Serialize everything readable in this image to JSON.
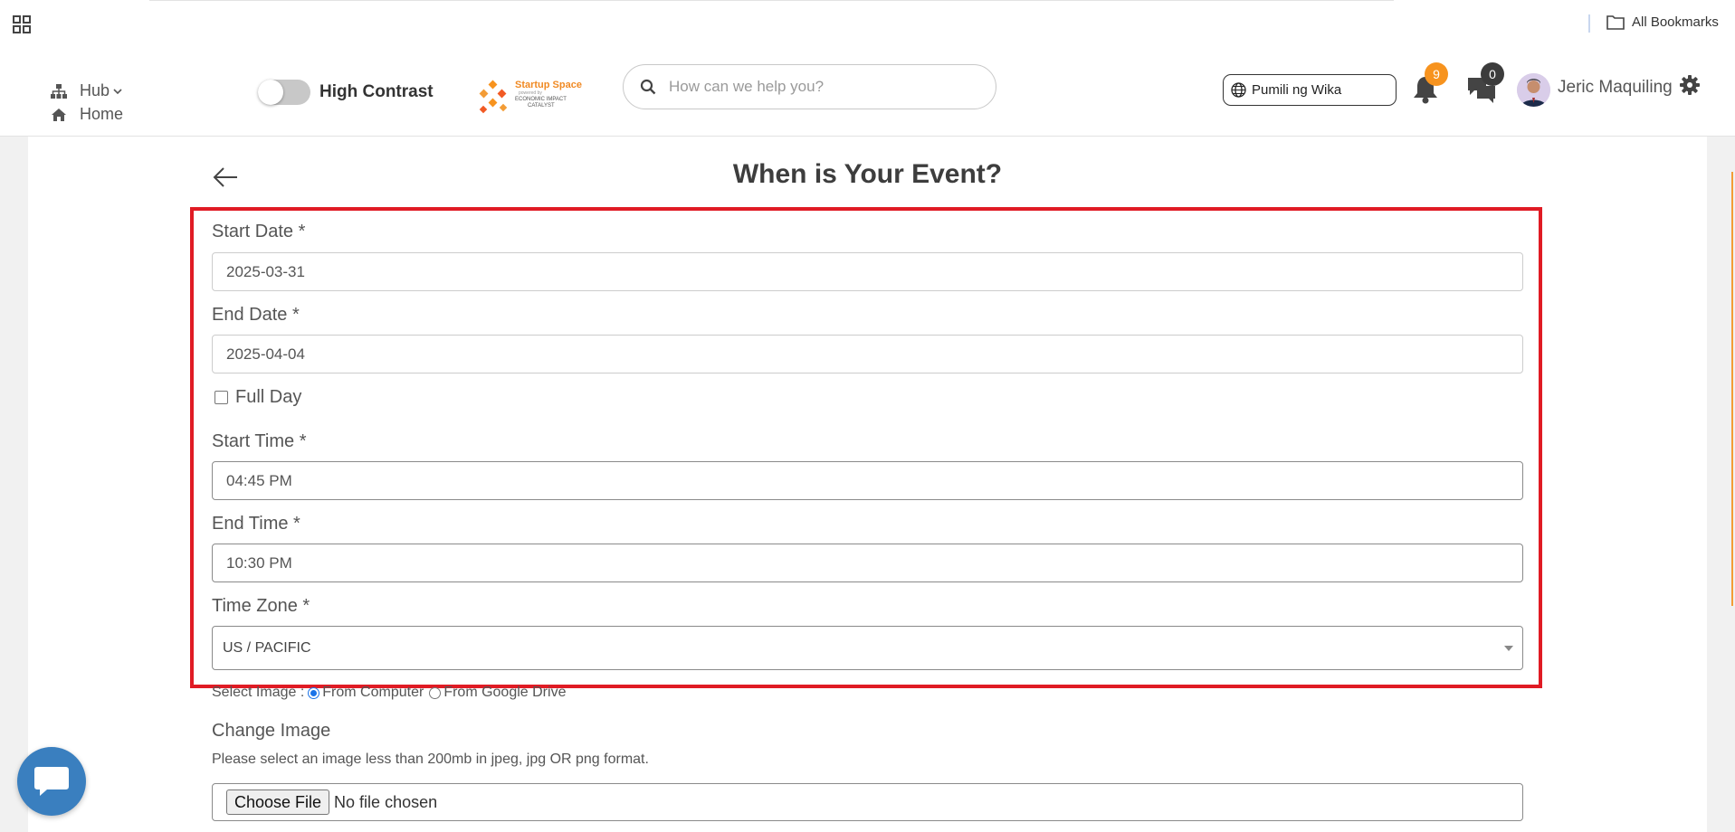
{
  "browser": {
    "all_bookmarks": "All Bookmarks"
  },
  "header": {
    "nav": {
      "hub": "Hub",
      "home": "Home"
    },
    "high_contrast_label": "High Contrast",
    "logo": {
      "line1": "Startup Space",
      "line2": "powered by",
      "line3": "ECONOMIC IMPACT",
      "line4": "CATALYST"
    },
    "search_placeholder": "How can we help you?",
    "language_button": "Pumili ng Wika",
    "notifications_count": "9",
    "messages_count": "0",
    "user_name": "Jeric Maquiling",
    "colors": {
      "accent": "#f7931e",
      "badge_dark": "#3c3c3c"
    }
  },
  "page": {
    "title": "When is Your Event?",
    "fields": {
      "start_date": {
        "label": "Start Date *",
        "value": "2025-03-31"
      },
      "end_date": {
        "label": "End Date *",
        "value": "2025-04-04"
      },
      "full_day": {
        "label": "Full Day",
        "checked": false
      },
      "start_time": {
        "label": "Start Time *",
        "value": "04:45 PM"
      },
      "end_time": {
        "label": "End Time *",
        "value": "10:30 PM"
      },
      "time_zone": {
        "label": "Time Zone *",
        "value": "US / PACIFIC"
      }
    },
    "select_image": {
      "label": "Select Image :",
      "option_computer": "From Computer",
      "option_drive": "From Google Drive",
      "selected": "From Computer"
    },
    "change_image": {
      "label": "Change Image",
      "help": "Please select an image less than 200mb in jpeg, jpg OR png format.",
      "button": "Choose File",
      "status": "No file chosen"
    },
    "highlight_color": "#e01b24"
  }
}
